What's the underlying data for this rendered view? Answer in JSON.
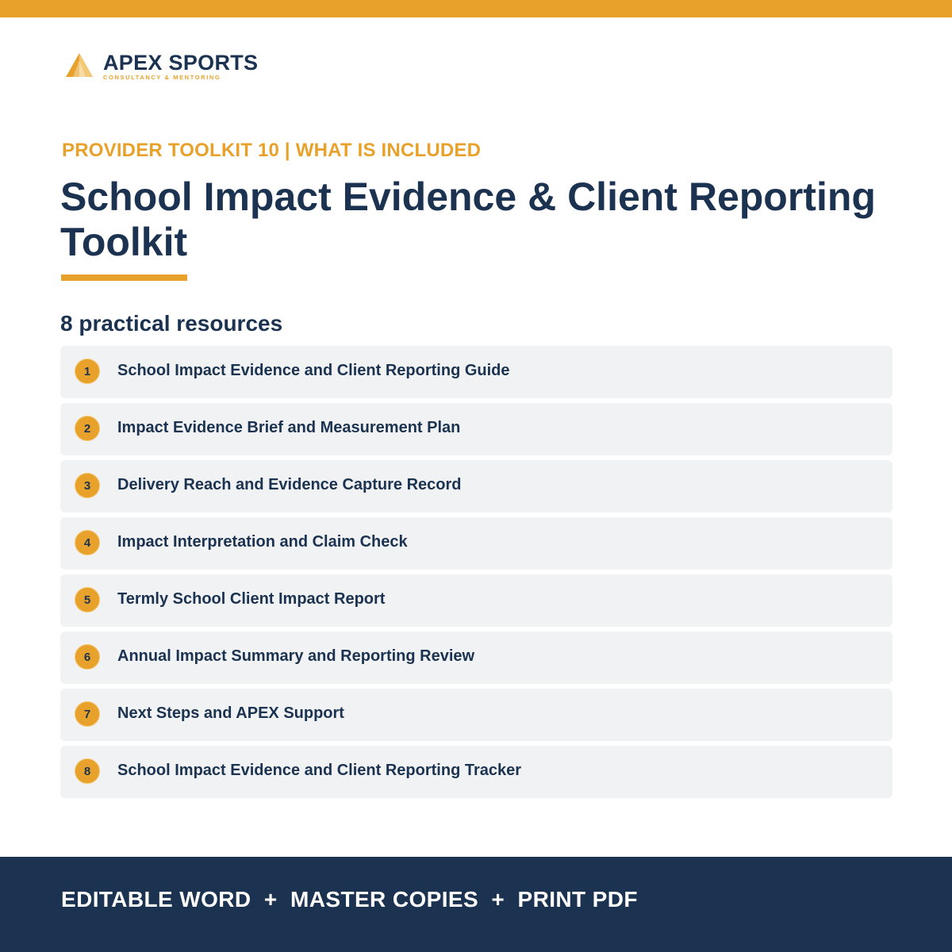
{
  "brand": {
    "name": "APEX SPORTS",
    "tagline": "CONSULTANCY & MENTORING",
    "logo_icon": "mountain-peak-icon",
    "colors": {
      "accent": "#e8a22c",
      "navy": "#1b3350",
      "item_bg": "#f1f2f4"
    }
  },
  "header": {
    "eyebrow": "PROVIDER TOOLKIT 10 | WHAT IS INCLUDED",
    "title": "School Impact Evidence & Client Reporting Toolkit"
  },
  "resources": {
    "heading": "8 practical resources",
    "items": [
      {
        "number": "1",
        "label": "School Impact Evidence and Client Reporting Guide"
      },
      {
        "number": "2",
        "label": "Impact Evidence Brief and Measurement Plan"
      },
      {
        "number": "3",
        "label": "Delivery Reach and Evidence Capture Record"
      },
      {
        "number": "4",
        "label": "Impact Interpretation and Claim Check"
      },
      {
        "number": "5",
        "label": "Termly School Client Impact Report"
      },
      {
        "number": "6",
        "label": "Annual Impact Summary and Reporting Review"
      },
      {
        "number": "7",
        "label": "Next Steps and APEX Support"
      },
      {
        "number": "8",
        "label": "School Impact Evidence and Client Reporting Tracker"
      }
    ]
  },
  "footer": {
    "formats": "EDITABLE WORD  +  MASTER COPIES  +  PRINT PDF"
  }
}
